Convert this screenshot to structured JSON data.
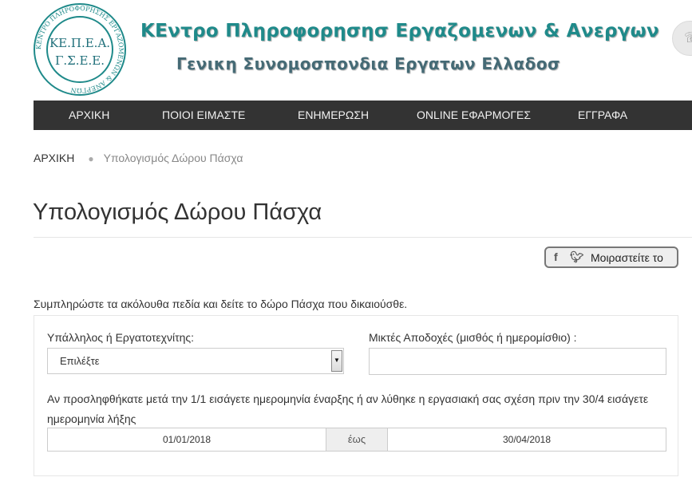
{
  "header": {
    "logo_text_line1": "ΚΕ.Π.Ε.Α.",
    "logo_text_line2": "Γ.Σ.Ε.Ε.",
    "logo_ring_text": "ΚΕΝΤΡΟ ΠΛΗΡΟΦΟΡΗΣΗΣ ΕΡΓΑΖΟΜΕΝΩΝ & ΑΝΕΡΓΩΝ",
    "title": "ΚΕντρο Πληροφορησησ Εργαζομενων & Ανεργων",
    "subtitle": "Γενικη Συνομοσπονδια Εργατων Ελλαδοσ",
    "brand_color": "#1f8a8a"
  },
  "nav": {
    "items": [
      {
        "label": "ΑΡΧΙΚΗ"
      },
      {
        "label": "ΠΟΙΟΙ ΕΙΜΑΣΤΕ"
      },
      {
        "label": "ΕΝΗΜΕΡΩΣΗ"
      },
      {
        "label": "ONLINE ΕΦΑΡΜΟΓΕΣ"
      },
      {
        "label": "ΕΓΓΡΑΦΑ"
      }
    ]
  },
  "breadcrumb": {
    "home": "ΑΡΧΙΚΗ",
    "current": "Υπολογισμός Δώρου Πάσχα"
  },
  "page": {
    "title": "Υπολογισμός Δώρου Πάσχα",
    "share_label": "Μοιραστείτε το",
    "intro": "Συμπληρώστε τα ακόλουθα πεδία και δείτε το δώρο Πάσχα που δικαιούσθε."
  },
  "form": {
    "employee_type_label": "Υπάλληλος ή Εργατοτεχνίτης:",
    "employee_type_value": "Επιλέξτε",
    "salary_label": "Μικτές Αποδοχές (μισθός ή ημερομίσθιο) :",
    "salary_value": "",
    "dates_note": "Αν προσληφθήκατε μετά την 1/1 εισάγετε ημερομηνία έναρξης ή αν λύθηκε η εργασιακή σας σχέση πριν την 30/4 εισάγετε ημερομηνία λήξης",
    "start_date": "01/01/2018",
    "range_separator": "έως",
    "end_date": "30/04/2018"
  }
}
